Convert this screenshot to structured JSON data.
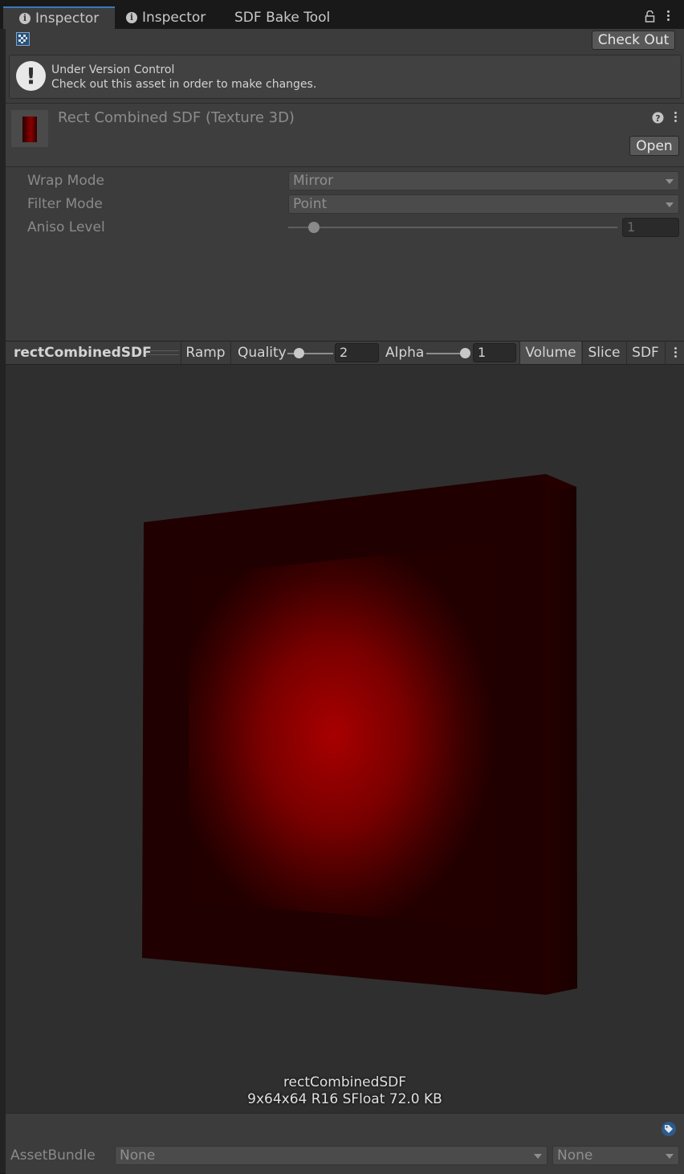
{
  "tabs": [
    {
      "label": "Inspector",
      "icon": "info-icon",
      "active": true
    },
    {
      "label": "Inspector",
      "icon": "info-icon",
      "active": false
    },
    {
      "label": "SDF Bake Tool",
      "active": false
    }
  ],
  "toolbar": {
    "check_out_label": "Check Out"
  },
  "version_control": {
    "title": "Under Version Control",
    "message": "Check out this asset in order to make changes."
  },
  "asset": {
    "title": "Rect Combined SDF (Texture 3D)",
    "open_label": "Open"
  },
  "properties": {
    "wrap_mode": {
      "label": "Wrap Mode",
      "value": "Mirror"
    },
    "filter_mode": {
      "label": "Filter Mode",
      "value": "Point"
    },
    "aniso_level": {
      "label": "Aniso Level",
      "value": "1",
      "slider_fraction": 0.06
    }
  },
  "preview_toolbar": {
    "asset_name": "rectCombinedSDF",
    "ramp_label": "Ramp",
    "quality_label": "Quality",
    "quality_value": "2",
    "alpha_label": "Alpha",
    "alpha_value": "1",
    "volume_label": "Volume",
    "slice_label": "Slice",
    "sdf_label": "SDF"
  },
  "preview_info": {
    "name": "rectCombinedSDF",
    "details": "9x64x64 R16 SFloat 72.0 KB"
  },
  "footer": {
    "asset_bundle_label": "AssetBundle",
    "bundle_value": "None",
    "variant_value": "None"
  },
  "colors": {
    "accent": "#3a79bb",
    "volume_red": "#a80000",
    "volume_dark": "#200000"
  }
}
